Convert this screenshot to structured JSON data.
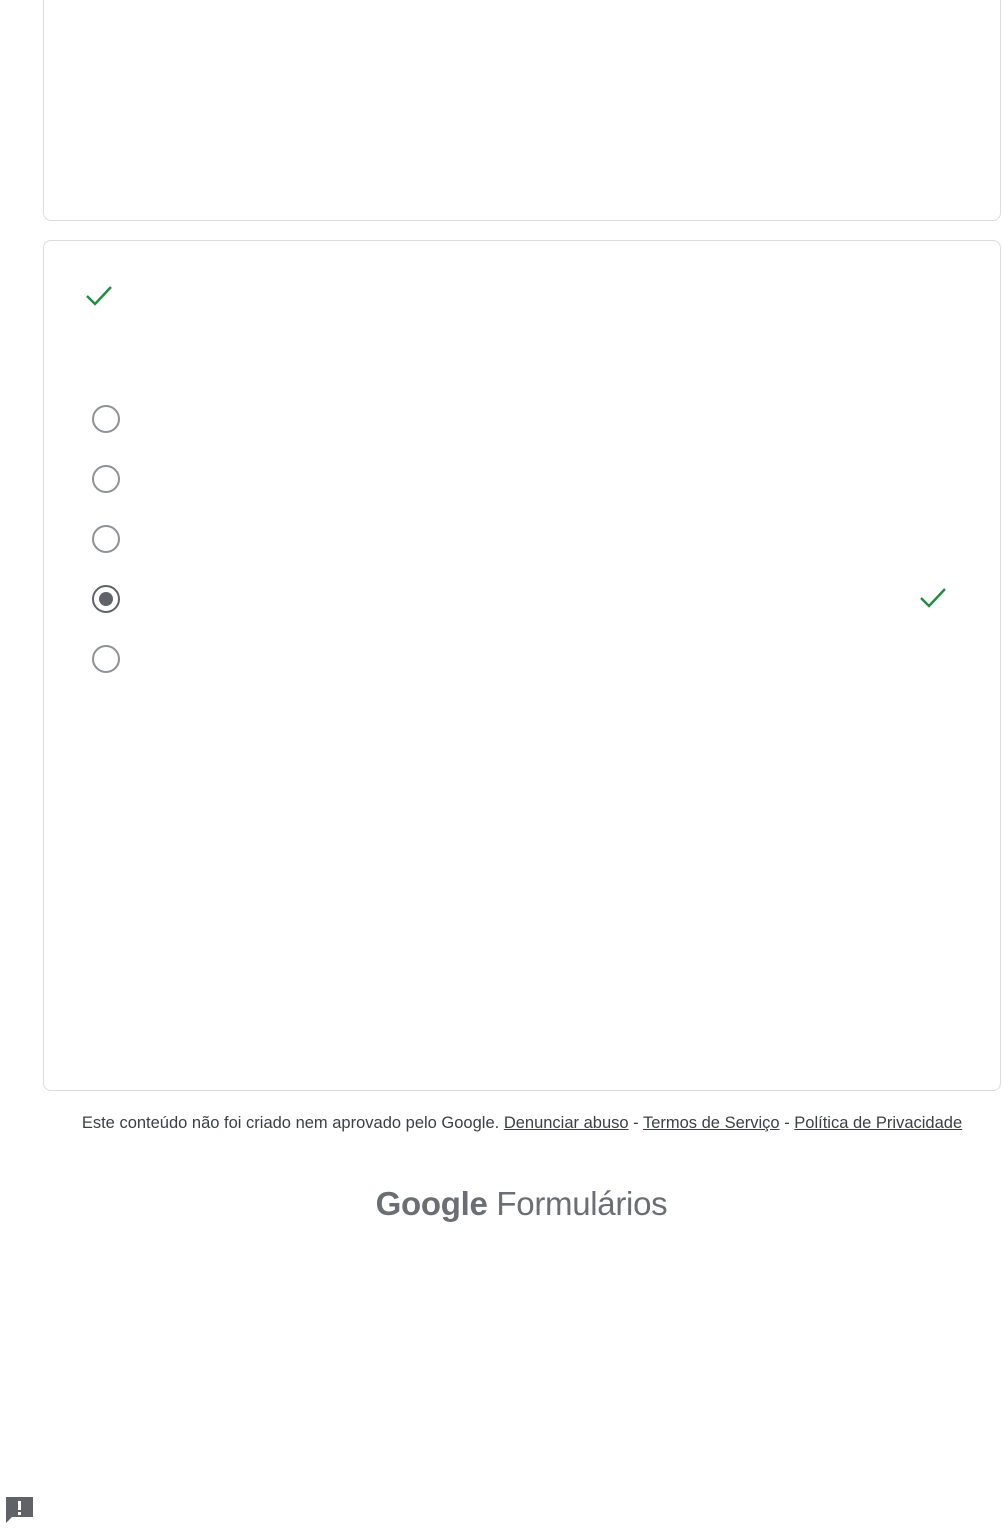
{
  "question": {
    "title": "",
    "correct_icon": "check-icon",
    "options": [
      {
        "label": "",
        "selected": false,
        "correct": false
      },
      {
        "label": "",
        "selected": false,
        "correct": false
      },
      {
        "label": "",
        "selected": false,
        "correct": false
      },
      {
        "label": "",
        "selected": true,
        "correct": true
      },
      {
        "label": "",
        "selected": false,
        "correct": false
      }
    ]
  },
  "footer": {
    "disclaimer": "Este conteúdo não foi criado nem aprovado pelo Google.",
    "report_abuse": "Denunciar abuso",
    "separator": "-",
    "terms": "Termos de Serviço",
    "privacy": "Política de Privacidade"
  },
  "brand": {
    "google": "Google",
    "product": "Formulários"
  },
  "report_button_icon": "report-icon",
  "colors": {
    "check": "#1e8e3e",
    "radio_border": "#8e9296",
    "radio_selected": "#5f6368",
    "card_border": "#dadce0",
    "footer_text": "#3c4043"
  }
}
